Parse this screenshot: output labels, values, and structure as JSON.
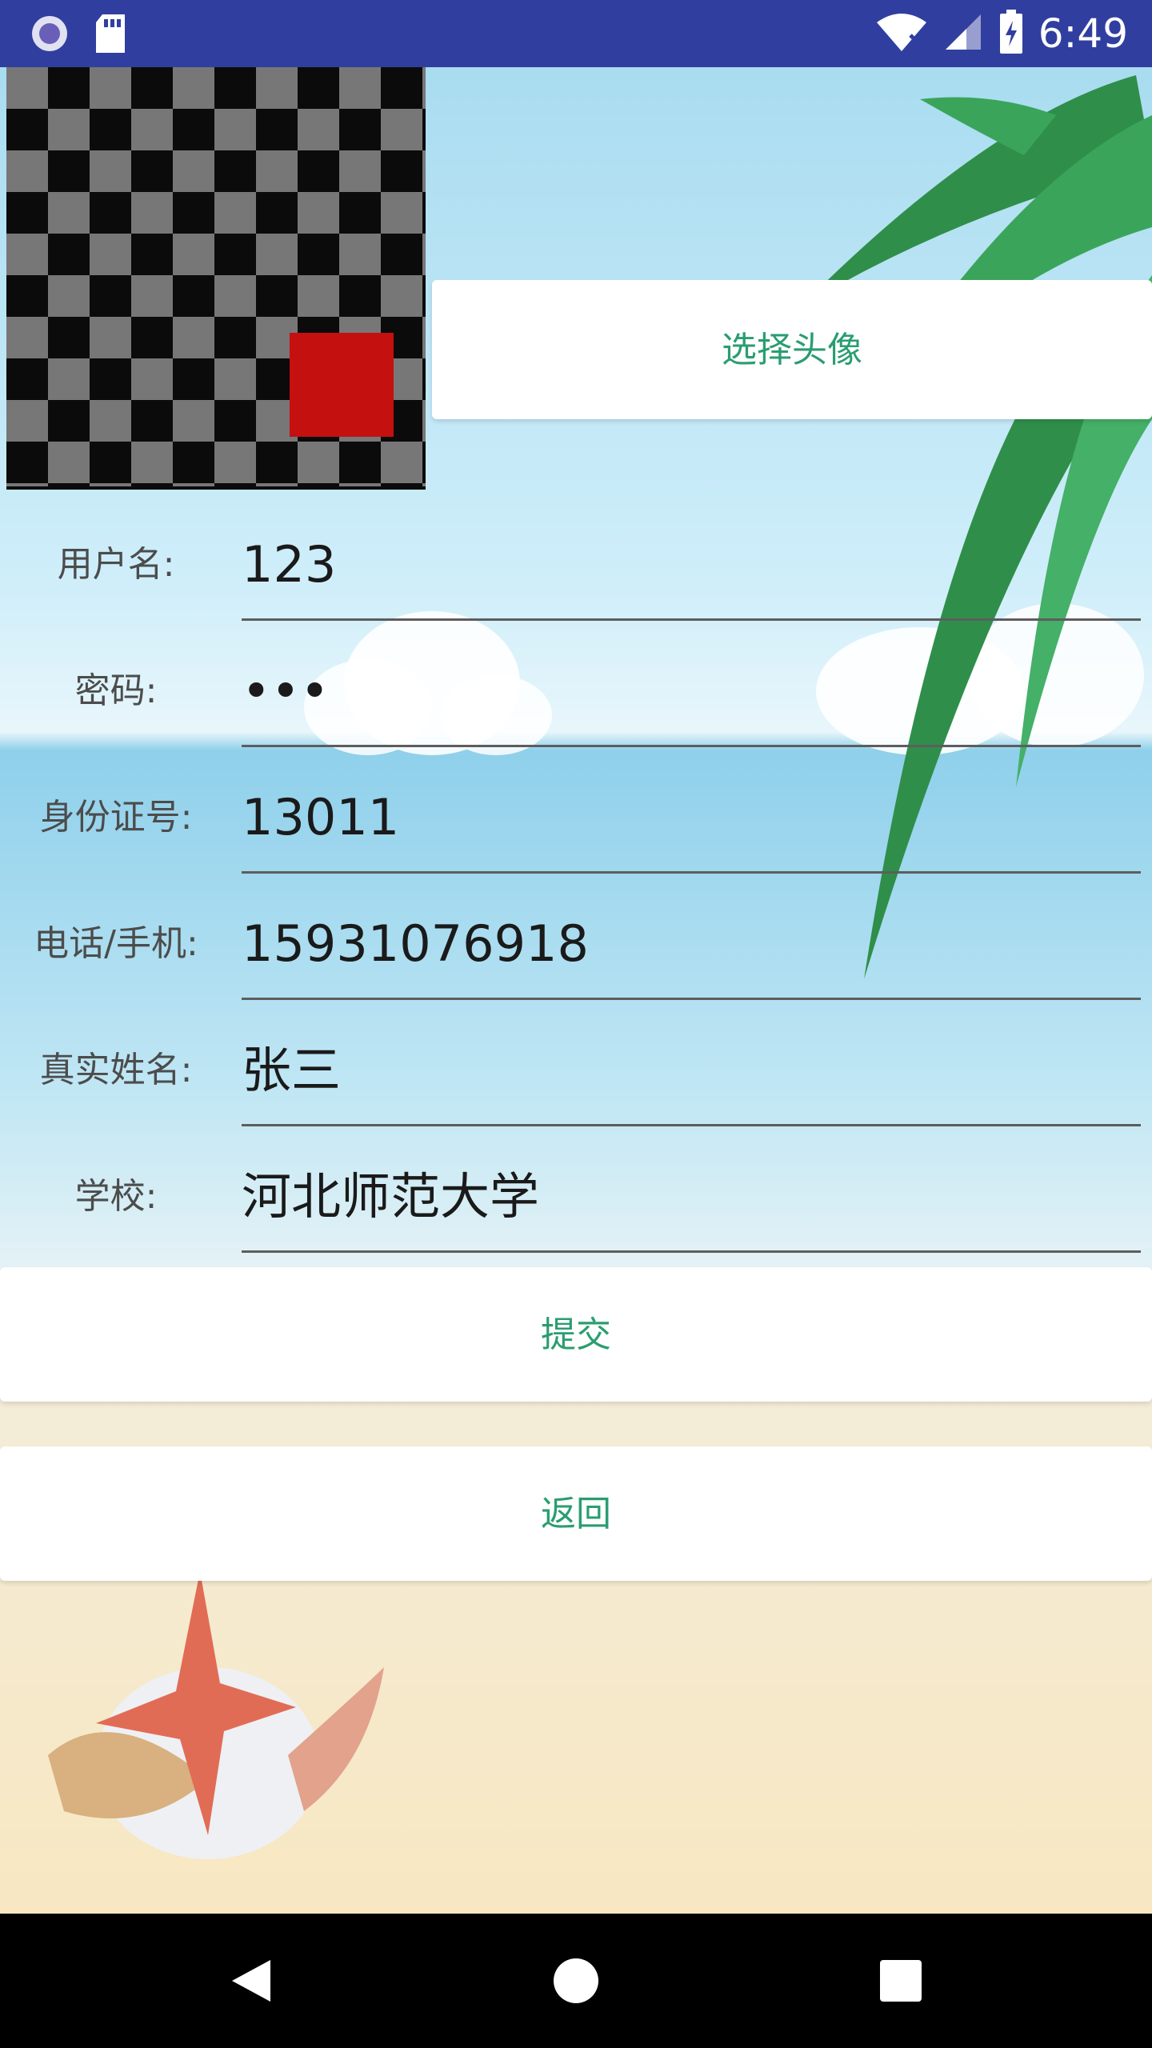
{
  "status_bar": {
    "time": "6:49",
    "icons_left": [
      "circle-record-icon",
      "sd-card-icon"
    ],
    "icons_right": [
      "wifi-off-icon",
      "cell-signal-icon",
      "battery-charging-icon"
    ]
  },
  "avatar": {
    "description": "checkerboard placeholder image with red square",
    "icon": "avatar-image"
  },
  "buttons": {
    "choose_avatar": "选择头像",
    "submit": "提交",
    "back": "返回"
  },
  "form": {
    "fields": [
      {
        "label": "用户名:",
        "value": "123"
      },
      {
        "label": "密码:",
        "value": "•••"
      },
      {
        "label": "身份证号:",
        "value": "13011"
      },
      {
        "label": "电话/手机:",
        "value": "15931076918"
      },
      {
        "label": "真实姓名:",
        "value": "张三"
      },
      {
        "label": "学校:",
        "value": "河北师范大学"
      }
    ]
  },
  "nav": {
    "back_icon": "back-triangle-icon",
    "home_icon": "home-circle-icon",
    "recents_icon": "recents-square-icon"
  },
  "colors": {
    "status_bar": "#303F9F",
    "button_text": "#2a9d70",
    "nav_bar": "#000000"
  }
}
